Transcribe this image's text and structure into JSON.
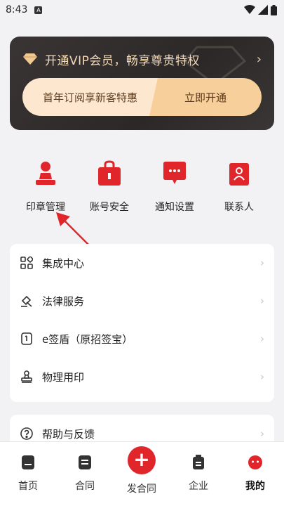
{
  "status": {
    "time": "8:43",
    "notif_icon": "A"
  },
  "vip": {
    "title": "开通VIP会员，畅享尊贵特权",
    "offer": "首年订阅享新客特惠",
    "cta": "立即开通"
  },
  "quick_actions": [
    {
      "label": "印章管理",
      "icon": "seal-icon"
    },
    {
      "label": "账号安全",
      "icon": "lock-bag-icon"
    },
    {
      "label": "通知设置",
      "icon": "chat-bubble-icon"
    },
    {
      "label": "联系人",
      "icon": "contact-icon"
    }
  ],
  "menu": [
    {
      "label": "集成中心",
      "icon": "grid-icon"
    },
    {
      "label": "法律服务",
      "icon": "gavel-icon"
    },
    {
      "label": "e签盾（原招签宝）",
      "icon": "key-device-icon"
    },
    {
      "label": "物理用印",
      "icon": "stamp-icon"
    }
  ],
  "menu2": [
    {
      "label": "帮助与反馈",
      "icon": "help-icon"
    }
  ],
  "nav": {
    "home": "首页",
    "contract": "合同",
    "send": "发合同",
    "company": "企业",
    "mine": "我的"
  },
  "colors": {
    "accent": "#e0252b",
    "vip_gold": "#f4d9b6",
    "vip_bg": "#2f2a2a"
  }
}
